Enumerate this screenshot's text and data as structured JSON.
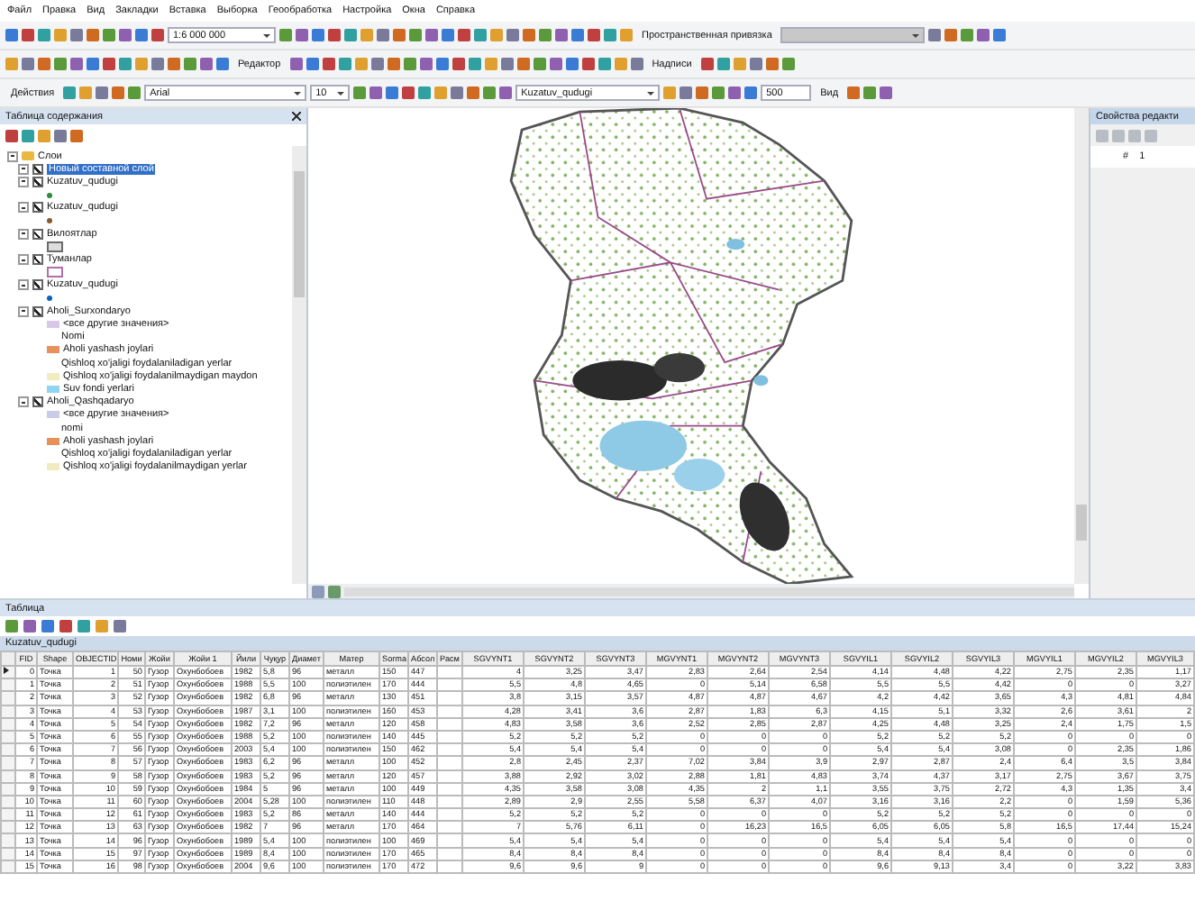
{
  "menu": [
    "Файл",
    "Правка",
    "Вид",
    "Закладки",
    "Вставка",
    "Выборка",
    "Геообработка",
    "Настройка",
    "Окна",
    "Справка"
  ],
  "toolbars": {
    "scale": "1:6 000 000",
    "georef": "Пространственная привязка",
    "editor": "Редактор",
    "labels": "Надписи",
    "actions": "Действия",
    "font": "Arial",
    "font_size": "10",
    "layer": "Kuzatuv_qudugi",
    "value": "500",
    "view": "Вид"
  },
  "toc": {
    "title": "Таблица содержания",
    "root": {
      "label": "Слои",
      "expanded": true,
      "children": [
        {
          "label": "Новый составной слой",
          "checked": true,
          "selected": true,
          "expanded": true
        },
        {
          "label": "Kuzatuv_qudugi",
          "checked": true,
          "selected": false,
          "expanded": true,
          "legend": [
            {
              "kind": "point",
              "color": "#2e8b3a"
            }
          ]
        },
        {
          "label": "Kuzatuv_qudugi",
          "checked": true,
          "selected": false,
          "expanded": true,
          "legend": [
            {
              "kind": "point",
              "color": "#8b5a2b"
            }
          ]
        },
        {
          "label": "Вилоятлар",
          "checked": true,
          "selected": false,
          "expanded": true,
          "legend": [
            {
              "kind": "fill",
              "color": "#6b6b6b"
            }
          ]
        },
        {
          "label": "Туманлар",
          "checked": true,
          "selected": false,
          "expanded": true,
          "legend": [
            {
              "kind": "outline",
              "color": "#b070a8"
            }
          ]
        },
        {
          "label": "Kuzatuv_qudugi",
          "checked": true,
          "selected": false,
          "expanded": true,
          "legend": [
            {
              "kind": "point",
              "color": "#1060c0"
            }
          ]
        },
        {
          "label": "Aholi_Surxondaryo",
          "checked": true,
          "selected": false,
          "expanded": true,
          "legend": [
            {
              "kind": "class",
              "label": "<все другие значения>",
              "color": "#d8c8e8"
            },
            {
              "kind": "heading",
              "label": "Nomi"
            },
            {
              "kind": "class",
              "label": "Aholi yashash joylari",
              "color": "#e8905a"
            },
            {
              "kind": "text",
              "label": "Qishloq xo'jaligi foydalaniladigan yerlar"
            },
            {
              "kind": "class",
              "label": "Qishloq xo'jaligi foydalanilmaydigan maydon",
              "color": "#f0ecc0"
            },
            {
              "kind": "class",
              "label": "Suv fondi yerlari",
              "color": "#8fd4f0"
            }
          ]
        },
        {
          "label": "Aholi_Qashqadaryo",
          "checked": true,
          "selected": false,
          "expanded": true,
          "legend": [
            {
              "kind": "class",
              "label": "<все другие значения>",
              "color": "#c8cce8"
            },
            {
              "kind": "heading",
              "label": "nomi"
            },
            {
              "kind": "class",
              "label": "Aholi yashash joylari",
              "color": "#e8905a"
            },
            {
              "kind": "text",
              "label": "Qishloq xo'jaligi foydalaniladigan yerlar"
            },
            {
              "kind": "class",
              "label": "Qishloq xo'jaligi foydalanilmaydigan yerlar",
              "color": "#f0ecc0"
            }
          ]
        }
      ]
    }
  },
  "editor_panel": {
    "title": "Свойства редакти",
    "cells": [
      "#",
      "1"
    ]
  },
  "table": {
    "title": "Таблица",
    "tab": "Kuzatuv_qudugi",
    "columns": [
      {
        "label": "FID",
        "kind": "number"
      },
      {
        "label": "Shape",
        "kind": "text"
      },
      {
        "label": "OBJECTID",
        "kind": "number"
      },
      {
        "label": "Номи",
        "kind": "number"
      },
      {
        "label": "Жойи",
        "kind": "text"
      },
      {
        "label": "Жойи 1",
        "kind": "text"
      },
      {
        "label": "Йили",
        "kind": "text"
      },
      {
        "label": "Чуқур",
        "kind": "text"
      },
      {
        "label": "Диамет",
        "kind": "text"
      },
      {
        "label": "Матер",
        "kind": "text"
      },
      {
        "label": "Sorma",
        "kind": "text"
      },
      {
        "label": "Абсол",
        "kind": "text"
      },
      {
        "label": "Расм",
        "kind": "text"
      },
      {
        "label": "SGVYNT1",
        "kind": "number"
      },
      {
        "label": "SGVYNT2",
        "kind": "number"
      },
      {
        "label": "SGVYNT3",
        "kind": "number"
      },
      {
        "label": "MGVYNT1",
        "kind": "number"
      },
      {
        "label": "MGVYNT2",
        "kind": "number"
      },
      {
        "label": "MGVYNT3",
        "kind": "number"
      },
      {
        "label": "SGVYIL1",
        "kind": "number"
      },
      {
        "label": "SGVYIL2",
        "kind": "number"
      },
      {
        "label": "SGVYIL3",
        "kind": "number"
      },
      {
        "label": "MGVYIL1",
        "kind": "number"
      },
      {
        "label": "MGVYIL2",
        "kind": "number"
      },
      {
        "label": "MGVYIL3",
        "kind": "number"
      }
    ],
    "rows": [
      {
        "selected": true,
        "cells": [
          "0",
          "Точка",
          "1",
          "50",
          "Гузор",
          "Охунбобоев",
          "1982",
          "5,8",
          "96",
          "металл",
          "150",
          "447",
          null,
          "4",
          "3,25",
          "3,47",
          "2,83",
          "2,64",
          "2,54",
          "4,14",
          "4,48",
          "4,22",
          "2,75",
          "2,35",
          "1,17"
        ]
      },
      {
        "selected": false,
        "cells": [
          "1",
          "Точка",
          "2",
          "51",
          "Гузор",
          "Охунбобоев",
          "1988",
          "5,5",
          "100",
          "полиэтилен",
          "170",
          "444",
          null,
          "5,5",
          "4,8",
          "4,65",
          "0",
          "5,14",
          "6,58",
          "5,5",
          "5,5",
          "4,42",
          "0",
          "0",
          "3,27"
        ]
      },
      {
        "selected": false,
        "cells": [
          "2",
          "Точка",
          "3",
          "52",
          "Гузор",
          "Охунбобоев",
          "1982",
          "6,8",
          "96",
          "металл",
          "130",
          "451",
          null,
          "3,8",
          "3,15",
          "3,57",
          "4,87",
          "4,87",
          "4,67",
          "4,2",
          "4,42",
          "3,65",
          "4,3",
          "4,81",
          "4,84"
        ]
      },
      {
        "selected": false,
        "cells": [
          "3",
          "Точка",
          "4",
          "53",
          "Гузор",
          "Охунбобоев",
          "1987",
          "3,1",
          "100",
          "полиэтилен",
          "160",
          "453",
          null,
          "4,28",
          "3,41",
          "3,6",
          "2,87",
          "1,83",
          "6,3",
          "4,15",
          "5,1",
          "3,32",
          "2,6",
          "3,61",
          "2"
        ]
      },
      {
        "selected": false,
        "cells": [
          "4",
          "Точка",
          "5",
          "54",
          "Гузор",
          "Охунбобоев",
          "1982",
          "7,2",
          "96",
          "металл",
          "120",
          "458",
          null,
          "4,83",
          "3,58",
          "3,6",
          "2,52",
          "2,85",
          "2,87",
          "4,25",
          "4,48",
          "3,25",
          "2,4",
          "1,75",
          "1,5"
        ]
      },
      {
        "selected": false,
        "cells": [
          "5",
          "Точка",
          "6",
          "55",
          "Гузор",
          "Охунбобоев",
          "1988",
          "5,2",
          "100",
          "полиэтилен",
          "140",
          "445",
          null,
          "5,2",
          "5,2",
          "5,2",
          "0",
          "0",
          "0",
          "5,2",
          "5,2",
          "5,2",
          "0",
          "0",
          "0"
        ]
      },
      {
        "selected": false,
        "cells": [
          "6",
          "Точка",
          "7",
          "56",
          "Гузор",
          "Охунбобоев",
          "2003",
          "5,4",
          "100",
          "полиэтилен",
          "150",
          "462",
          null,
          "5,4",
          "5,4",
          "5,4",
          "0",
          "0",
          "0",
          "5,4",
          "5,4",
          "3,08",
          "0",
          "2,35",
          "1,86"
        ]
      },
      {
        "selected": false,
        "cells": [
          "7",
          "Точка",
          "8",
          "57",
          "Гузор",
          "Охунбобоев",
          "1983",
          "6,2",
          "96",
          "металл",
          "100",
          "452",
          null,
          "2,8",
          "2,45",
          "2,37",
          "7,02",
          "3,84",
          "3,9",
          "2,97",
          "2,87",
          "2,4",
          "6,4",
          "3,5",
          "3,84"
        ]
      },
      {
        "selected": false,
        "cells": [
          "8",
          "Точка",
          "9",
          "58",
          "Гузор",
          "Охунбобоев",
          "1983",
          "5,2",
          "96",
          "металл",
          "120",
          "457",
          null,
          "3,88",
          "2,92",
          "3,02",
          "2,88",
          "1,81",
          "4,83",
          "3,74",
          "4,37",
          "3,17",
          "2,75",
          "3,67",
          "3,75"
        ]
      },
      {
        "selected": false,
        "cells": [
          "9",
          "Точка",
          "10",
          "59",
          "Гузор",
          "Охунбобоев",
          "1984",
          "5",
          "96",
          "металл",
          "100",
          "449",
          null,
          "4,35",
          "3,58",
          "3,08",
          "4,35",
          "2",
          "1,1",
          "3,55",
          "3,75",
          "2,72",
          "4,3",
          "1,35",
          "3,4"
        ]
      },
      {
        "selected": false,
        "cells": [
          "10",
          "Точка",
          "11",
          "60",
          "Гузор",
          "Охунбобоев",
          "2004",
          "5,28",
          "100",
          "полиэтилен",
          "110",
          "448",
          null,
          "2,89",
          "2,9",
          "2,55",
          "5,58",
          "6,37",
          "4,07",
          "3,16",
          "3,16",
          "2,2",
          "0",
          "1,59",
          "5,36"
        ]
      },
      {
        "selected": false,
        "cells": [
          "11",
          "Точка",
          "12",
          "61",
          "Гузор",
          "Охунбобоев",
          "1983",
          "5,2",
          "86",
          "металл",
          "140",
          "444",
          null,
          "5,2",
          "5,2",
          "5,2",
          "0",
          "0",
          "0",
          "5,2",
          "5,2",
          "5,2",
          "0",
          "0",
          "0"
        ]
      },
      {
        "selected": false,
        "cells": [
          "12",
          "Точка",
          "13",
          "63",
          "Гузор",
          "Охунбобоев",
          "1982",
          "7",
          "96",
          "металл",
          "170",
          "464",
          null,
          "7",
          "5,76",
          "6,11",
          "0",
          "16,23",
          "16,5",
          "6,05",
          "6,05",
          "5,8",
          "16,5",
          "17,44",
          "15,24"
        ]
      },
      {
        "selected": false,
        "cells": [
          "13",
          "Точка",
          "14",
          "96",
          "Гузор",
          "Охунбобоев",
          "1989",
          "5,4",
          "100",
          "полиэтилен",
          "100",
          "469",
          null,
          "5,4",
          "5,4",
          "5,4",
          "0",
          "0",
          "0",
          "5,4",
          "5,4",
          "5,4",
          "0",
          "0",
          "0"
        ]
      },
      {
        "selected": false,
        "cells": [
          "14",
          "Точка",
          "15",
          "97",
          "Гузор",
          "Охунбобоев",
          "1989",
          "8,4",
          "100",
          "полиэтилен",
          "170",
          "465",
          null,
          "8,4",
          "8,4",
          "8,4",
          "0",
          "0",
          "0",
          "8,4",
          "8,4",
          "8,4",
          "0",
          "0",
          "0"
        ]
      },
      {
        "selected": false,
        "cells": [
          "15",
          "Точка",
          "16",
          "98",
          "Гузор",
          "Охунбобоев",
          "2004",
          "9,6",
          "100",
          "полиэтилен",
          "170",
          "472",
          null,
          "9,6",
          "9,6",
          "9",
          "0",
          "0",
          "0",
          "9,6",
          "9,13",
          "3,4",
          "0",
          "3,22",
          "3,83"
        ]
      }
    ]
  }
}
